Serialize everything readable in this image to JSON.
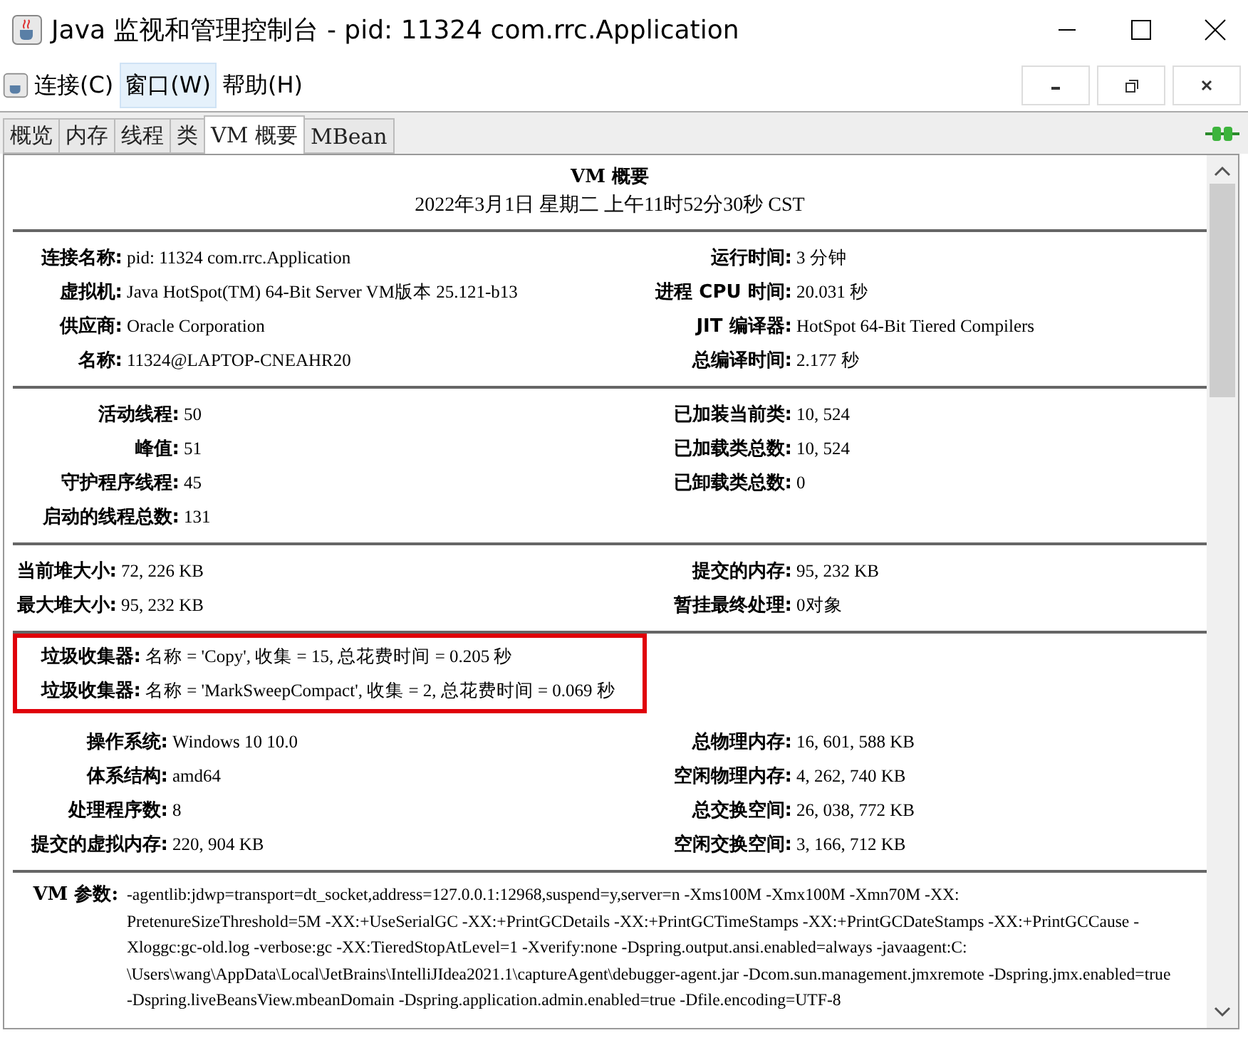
{
  "window": {
    "title": "Java 监视和管理控制台 - pid: 11324 com.rrc.Application"
  },
  "menu": [
    {
      "label": "连接(C)",
      "selected": false
    },
    {
      "label": "窗口(W)",
      "selected": true
    },
    {
      "label": "帮助(H)",
      "selected": false
    }
  ],
  "tabs": [
    {
      "label": "概览",
      "selected": false
    },
    {
      "label": "内存",
      "selected": false
    },
    {
      "label": "线程",
      "selected": false
    },
    {
      "label": "类",
      "selected": false
    },
    {
      "label": "VM 概要",
      "selected": true
    },
    {
      "label": "MBean",
      "selected": false
    }
  ],
  "summary": {
    "title": "VM 概要",
    "date": "2022年3月1日 星期二 上午11时52分30秒 CST"
  },
  "sections": [
    {
      "kind": "plain",
      "rows": [
        {
          "left": {
            "label": "连接名称:",
            "value": "pid: 11324 com.rrc.Application"
          },
          "right": {
            "label": "运行时间:",
            "value": "3 分钟"
          }
        },
        {
          "left": {
            "label": "虚拟机:",
            "value": "Java HotSpot(TM) 64-Bit Server VM版本 25.121-b13"
          },
          "right": {
            "label": "进程 CPU 时间:",
            "value": "20.031 秒"
          }
        },
        {
          "left": {
            "label": "供应商:",
            "value": "Oracle Corporation"
          },
          "right": {
            "label": "JIT 编译器:",
            "value": "HotSpot 64-Bit Tiered Compilers"
          }
        },
        {
          "left": {
            "label": "名称:",
            "value": "11324@LAPTOP-CNEAHR20"
          },
          "right": {
            "label": "总编译时间:",
            "value": "2.177 秒"
          }
        }
      ]
    },
    {
      "kind": "plain",
      "rows": [
        {
          "left": {
            "label": "活动线程:",
            "value": "50"
          },
          "right": {
            "label": "已加装当前类:",
            "value": "10, 524"
          }
        },
        {
          "left": {
            "label": "峰值:",
            "value": "51"
          },
          "right": {
            "label": "已加载类总数:",
            "value": "10, 524"
          }
        },
        {
          "left": {
            "label": "守护程序线程:",
            "value": "45"
          },
          "right": {
            "label": "已卸载类总数:",
            "value": "0"
          }
        },
        {
          "left": {
            "label": "启动的线程总数:",
            "value": "131"
          }
        }
      ]
    },
    {
      "kind": "plain",
      "rows": [
        {
          "left": {
            "label": "当前堆大小:",
            "value": "72, 226 KB"
          },
          "right": {
            "label": "提交的内存:",
            "value": "95, 232 KB"
          }
        },
        {
          "left": {
            "label": "最大堆大小:",
            "value": "95, 232 KB"
          },
          "right": {
            "label": "暂挂最终处理:",
            "value": "0对象"
          }
        }
      ]
    },
    {
      "kind": "highlighted",
      "rows": [
        {
          "left": {
            "label": "垃圾收集器:",
            "value": "名称 = 'Copy', 收集 = 15, 总花费时间 = 0.205 秒"
          }
        },
        {
          "left": {
            "label": "垃圾收集器:",
            "value": "名称 = 'MarkSweepCompact', 收集 = 2, 总花费时间 = 0.069 秒"
          }
        }
      ]
    },
    {
      "kind": "plain",
      "rows": [
        {
          "left": {
            "label": "操作系统:",
            "value": "Windows 10 10.0"
          },
          "right": {
            "label": "总物理内存:",
            "value": "16, 601, 588 KB"
          }
        },
        {
          "left": {
            "label": "体系结构:",
            "value": "amd64"
          },
          "right": {
            "label": "空闲物理内存:",
            "value": "4, 262, 740 KB"
          }
        },
        {
          "left": {
            "label": "处理程序数:",
            "value": "8"
          },
          "right": {
            "label": "总交换空间:",
            "value": "26, 038, 772 KB"
          }
        },
        {
          "left": {
            "label": "提交的虚拟内存:",
            "value": "220, 904 KB"
          },
          "right": {
            "label": "空闲交换空间:",
            "value": "3, 166, 712 KB"
          }
        }
      ]
    }
  ],
  "vm_args": {
    "label": "VM 参数:",
    "lines": [
      "-agentlib:jdwp=transport=dt_socket,address=127.0.0.1:12968,suspend=y,server=n -Xms100M -Xmx100M -Xmn70M -XX:",
      "PretenureSizeThreshold=5M -XX:+UseSerialGC -XX:+PrintGCDetails -XX:+PrintGCTimeStamps -XX:+PrintGCDateStamps -XX:+PrintGCCause -",
      "Xloggc:gc-old.log -verbose:gc -XX:TieredStopAtLevel=1 -Xverify:none -Dspring.output.ansi.enabled=always -javaagent:C:",
      "\\Users\\wang\\AppData\\Local\\JetBrains\\IntelliJIdea2021.1\\captureAgent\\debugger-agent.jar -Dcom.sun.management.jmxremote -Dspring.jmx.enabled=true",
      "-Dspring.liveBeansView.mbeanDomain -Dspring.application.admin.enabled=true -Dfile.encoding=UTF-8"
    ]
  }
}
